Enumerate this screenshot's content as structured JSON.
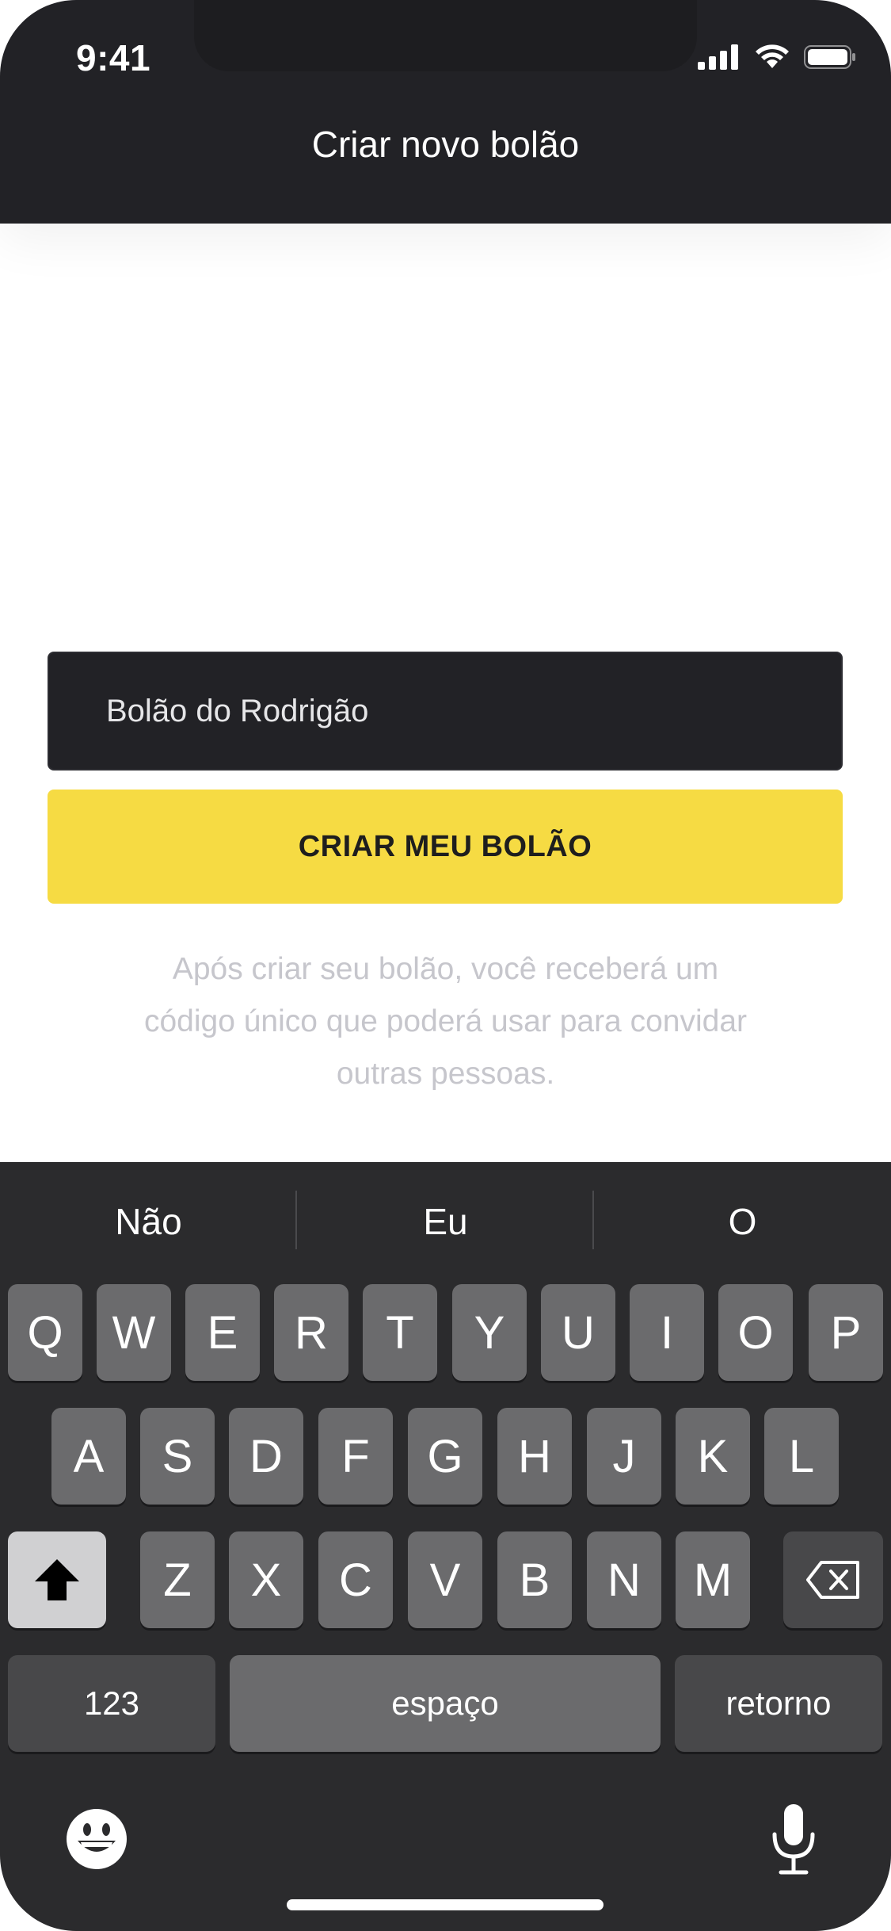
{
  "status_bar": {
    "time": "9:41"
  },
  "header": {
    "title": "Criar novo bolão"
  },
  "form": {
    "name_value": "Bolão do Rodrigão",
    "submit_label": "CRIAR MEU BOLÃO",
    "helper_lines": [
      "Após criar seu bolão, você receberá um",
      "código único que poderá usar para convidar",
      "outras pessoas."
    ]
  },
  "keyboard": {
    "suggestions": [
      "Não",
      "Eu",
      "O"
    ],
    "row1": [
      "Q",
      "W",
      "E",
      "R",
      "T",
      "Y",
      "U",
      "I",
      "O",
      "P"
    ],
    "row2": [
      "A",
      "S",
      "D",
      "F",
      "G",
      "H",
      "J",
      "K",
      "L"
    ],
    "row3": [
      "Z",
      "X",
      "C",
      "V",
      "B",
      "N",
      "M"
    ],
    "numbers_label": "123",
    "space_label": "espaço",
    "return_label": "retorno",
    "icons": {
      "shift": "shift-icon",
      "delete": "backspace-icon",
      "emoji": "emoji-icon",
      "dictation": "microphone-icon"
    }
  },
  "colors": {
    "header_bg": "#222226",
    "accent": "#f6db43",
    "keyboard_bg": "#2b2b2d"
  }
}
